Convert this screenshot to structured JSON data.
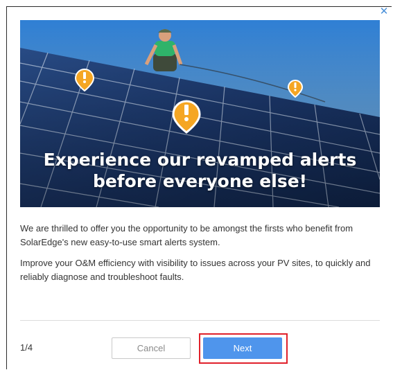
{
  "dialog": {
    "close_glyph": "✕",
    "hero": {
      "headline_line1": "Experience our revamped alerts",
      "headline_line2": "before everyone else!",
      "icons": [
        "alert-pin-icon",
        "alert-pin-icon",
        "alert-pin-icon"
      ]
    },
    "paragraphs": [
      "We are thrilled to offer you the opportunity to be amongst the firsts who benefit from SolarEdge's new easy-to-use smart alerts system.",
      "Improve your O&M efficiency with visibility to issues across your PV sites, to quickly and reliably diagnose and troubleshoot faults."
    ],
    "pager": "1/4",
    "cancel_label": "Cancel",
    "next_label": "Next"
  },
  "colors": {
    "accent": "#4f95ec",
    "highlight": "#e0202a",
    "alert": "#f5a623",
    "close": "#4a90d9"
  }
}
